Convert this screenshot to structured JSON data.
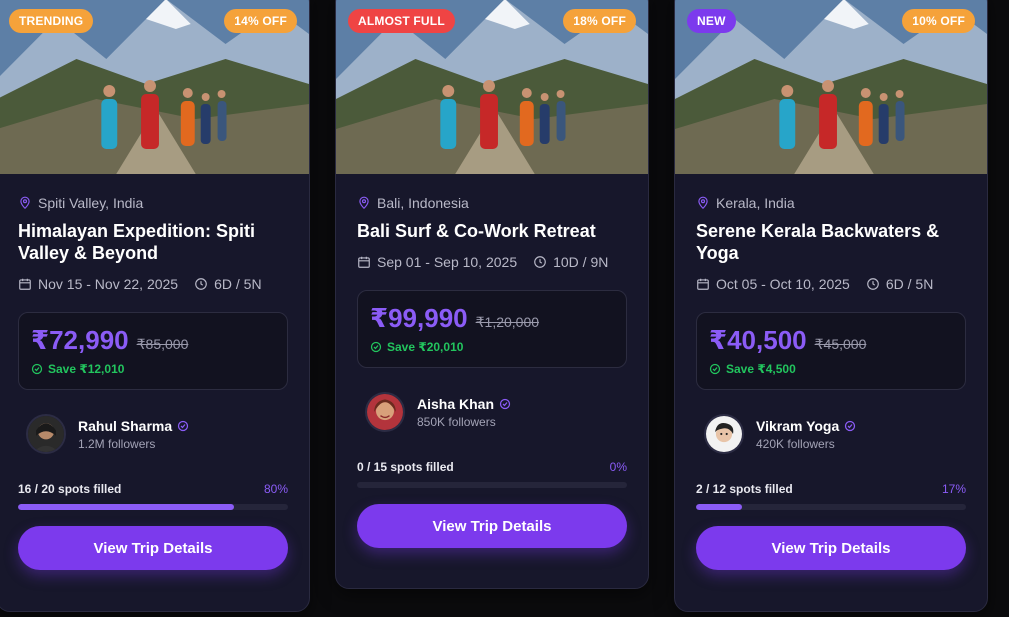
{
  "colors": {
    "accent": "#8b5cf6",
    "button": "#7c3aed",
    "save_green": "#22c55e",
    "discount_badge": "#f5a23a",
    "trending_badge": "#f5a23a",
    "almost_full_badge": "#ef4444",
    "new_badge": "#7c3aed"
  },
  "cards": [
    {
      "badge": "TRENDING",
      "discount": "14% OFF",
      "location": "Spiti Valley, India",
      "title": "Himalayan Expedition: Spiti Valley & Beyond",
      "dates": "Nov 15 - Nov 22, 2025",
      "duration": "6D / 5N",
      "price": "₹72,990",
      "original_price": "₹85,000",
      "savings": "Save ₹12,010",
      "host_name": "Rahul Sharma",
      "host_followers": "1.2M followers",
      "spots_text": "16 / 20 spots filled",
      "spots_percent": "80%",
      "spots_fraction": 0.8,
      "button_label": "View Trip Details"
    },
    {
      "badge": "ALMOST FULL",
      "discount": "18% OFF",
      "location": "Bali, Indonesia",
      "title": "Bali Surf & Co-Work Retreat",
      "dates": "Sep 01 - Sep 10, 2025",
      "duration": "10D / 9N",
      "price": "₹99,990",
      "original_price": "₹1,20,000",
      "savings": "Save ₹20,010",
      "host_name": "Aisha Khan",
      "host_followers": "850K followers",
      "spots_text": "0 / 15 spots filled",
      "spots_percent": "0%",
      "spots_fraction": 0,
      "button_label": "View Trip Details"
    },
    {
      "badge": "NEW",
      "discount": "10% OFF",
      "location": "Kerala, India",
      "title": "Serene Kerala Backwaters & Yoga",
      "dates": "Oct 05 - Oct 10, 2025",
      "duration": "6D / 5N",
      "price": "₹40,500",
      "original_price": "₹45,000",
      "savings": "Save ₹4,500",
      "host_name": "Vikram Yoga",
      "host_followers": "420K followers",
      "spots_text": "2 / 12 spots filled",
      "spots_percent": "17%",
      "spots_fraction": 0.17,
      "button_label": "View Trip Details"
    }
  ],
  "icons": {
    "location": "map-pin-icon",
    "calendar": "calendar-icon",
    "clock": "clock-icon",
    "check": "check-circle-icon",
    "verified": "verified-badge-icon"
  }
}
